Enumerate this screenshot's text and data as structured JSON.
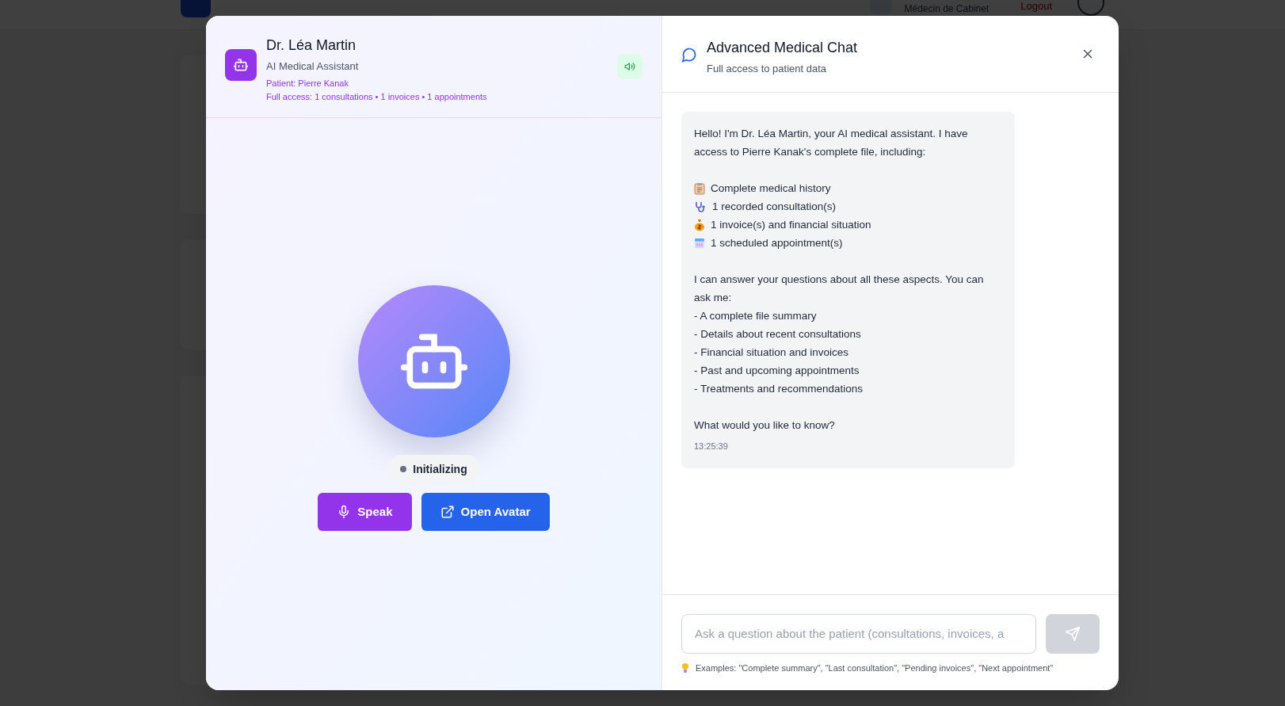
{
  "background": {
    "user_role": "Médecin de Cabinet",
    "logout": "Logout"
  },
  "assistant": {
    "name": "Dr. Léa Martin",
    "role": "AI Medical Assistant",
    "patient": "Patient: Pierre Kanak",
    "access": "Full access: 1 consultations • 1 invoices • 1 appointments",
    "sound_on": true,
    "status": "Initializing",
    "buttons": [
      {
        "kind": "speak",
        "label": "Speak"
      },
      {
        "kind": "avatar",
        "label": "Open Avatar"
      }
    ]
  },
  "chat": {
    "title": "Advanced Medical Chat",
    "subtitle": "Full access to patient data",
    "messages": [
      {
        "intro": "Hello! I'm Dr. Léa Martin, your AI medical assistant. I have access to Pierre Kanak's complete file, including:",
        "items": [
          {
            "kind": "history",
            "text": "Complete medical history"
          },
          {
            "kind": "consultations",
            "text": "1 recorded consultation(s)"
          },
          {
            "kind": "invoices",
            "text": "1 invoice(s) and financial situation"
          },
          {
            "kind": "appointments",
            "text": "1 scheduled appointment(s)"
          }
        ],
        "paragraph": "I can answer your questions about all these aspects. You can ask me:",
        "bullets": [
          "- A complete file summary",
          "- Details about recent consultations",
          "- Financial situation and invoices",
          "- Past and upcoming appointments",
          "- Treatments and recommendations"
        ],
        "question": "What would you like to know?",
        "time": "13:25:39"
      }
    ],
    "input": {
      "placeholder": "Ask a question about the patient (consultations, invoices, a",
      "send_disabled": true
    },
    "hint": "Examples: \"Complete summary\", \"Last consultation\", \"Pending invoices\", \"Next appointment\""
  }
}
